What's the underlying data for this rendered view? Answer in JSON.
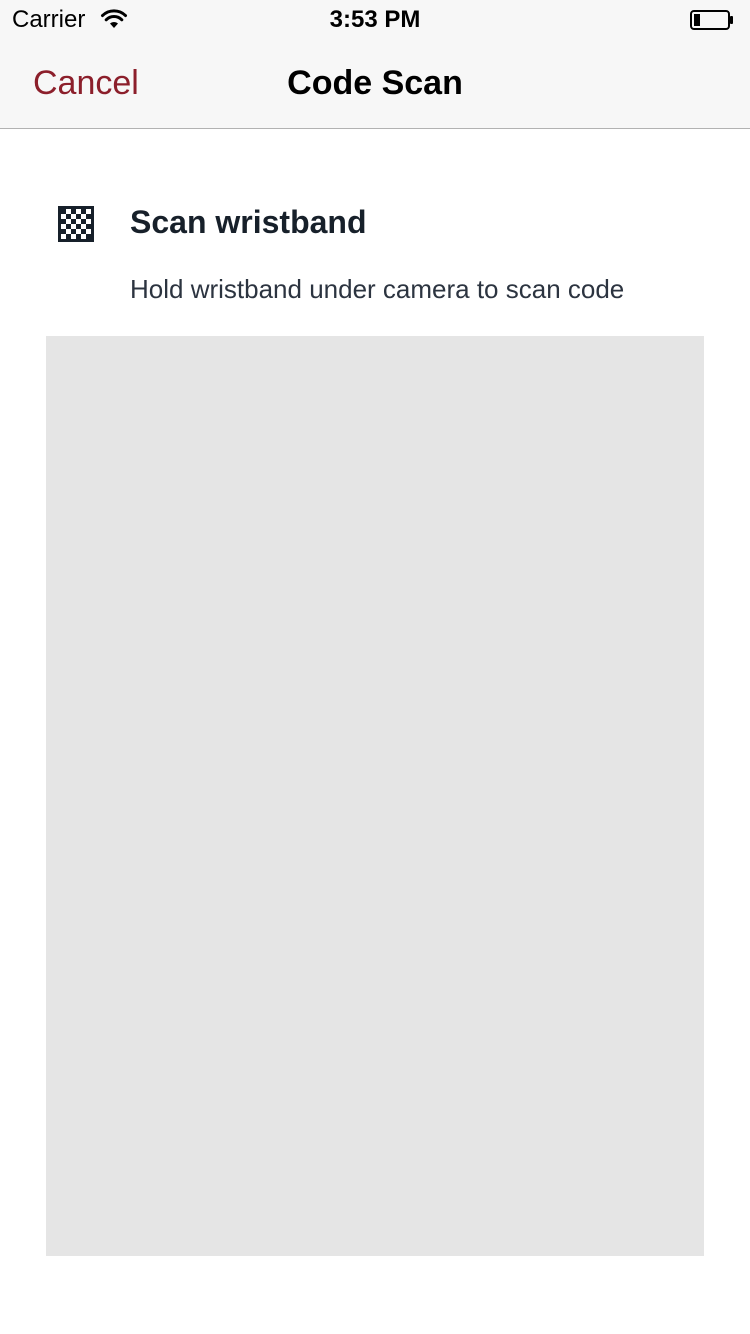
{
  "status_bar": {
    "carrier": "Carrier",
    "time": "3:53 PM",
    "wifi_icon": "wifi-icon",
    "battery_icon": "battery-icon",
    "battery_level": 0.2
  },
  "nav": {
    "cancel_label": "Cancel",
    "title": "Code Scan",
    "accent_color": "#8c1f2b"
  },
  "scan": {
    "icon": "qr-code-icon",
    "title": "Scan wristband",
    "subtitle": "Hold wristband under camera to scan code"
  },
  "camera": {
    "background_color": "#e5e5e5"
  }
}
